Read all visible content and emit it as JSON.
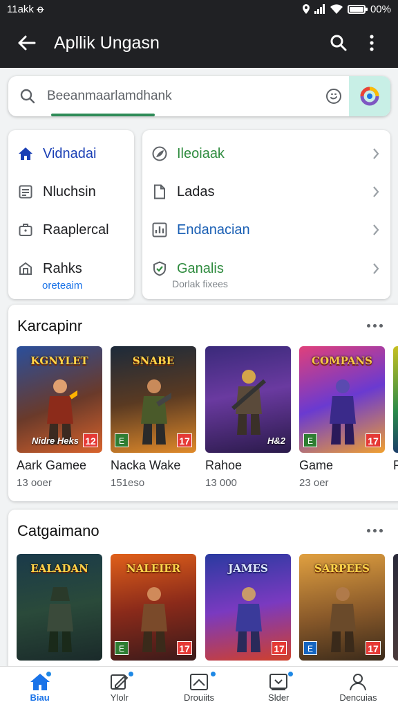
{
  "status_bar": {
    "time": "11akk ꝋ",
    "battery": "00%"
  },
  "app_bar": {
    "title": "Apllik Ungasn"
  },
  "search": {
    "placeholder": "Beeanmaarlamdhank"
  },
  "quick_menu": {
    "left": [
      {
        "label": "Vidnadai",
        "icon": "home-icon",
        "color": "#1a3fb5"
      },
      {
        "label": "Nluchsin",
        "icon": "document-icon",
        "color": "#202124"
      },
      {
        "label": "Raaplercal",
        "icon": "briefcase-icon",
        "color": "#202124"
      },
      {
        "label": "Rahks",
        "icon": "store-icon",
        "color": "#202124",
        "sublabel": "oreteaim"
      }
    ],
    "right": [
      {
        "label": "Ileoiaak",
        "icon": "leaf-icon",
        "color": "#2e8b3e"
      },
      {
        "label": "Ladas",
        "icon": "file-icon",
        "color": "#202124"
      },
      {
        "label": "Endanacian",
        "icon": "chart-icon",
        "color": "#1a5fb4"
      },
      {
        "label": "Ganalis",
        "icon": "shield-icon",
        "color": "#2e8b3e",
        "sublabel": "Dorlak fixees"
      }
    ]
  },
  "sections": [
    {
      "title": "Karcapinr",
      "items": [
        {
          "name": "Aark Gamee",
          "meta": "13 ooer",
          "banner": "KGNYLET",
          "caption": "Nidre Heks",
          "rating": "12"
        },
        {
          "name": "Nacka Wake",
          "meta": "151eso",
          "banner": "SNABE",
          "caption": "",
          "rating": "17"
        },
        {
          "name": "Rahoe",
          "meta": "13 000",
          "banner": "",
          "caption": "H&2",
          "rating": ""
        },
        {
          "name": "Game",
          "meta": "23 oer",
          "banner": "COMPANS",
          "caption": "",
          "rating": "17"
        },
        {
          "name": "P",
          "meta": "",
          "banner": "",
          "caption": "",
          "rating": ""
        }
      ]
    },
    {
      "title": "Catgaimano",
      "items": [
        {
          "name": "",
          "meta": "",
          "banner": "EALADAN",
          "caption": "",
          "rating": ""
        },
        {
          "name": "",
          "meta": "",
          "banner": "NALEIER",
          "caption": "",
          "rating": "17"
        },
        {
          "name": "",
          "meta": "",
          "banner": "JAMES",
          "caption": "",
          "rating": "17"
        },
        {
          "name": "",
          "meta": "",
          "banner": "SARPEES",
          "caption": "",
          "rating": "17"
        }
      ]
    }
  ],
  "bottom_nav": [
    {
      "label": "Biau",
      "icon": "home-icon",
      "active": true
    },
    {
      "label": "Ylolr",
      "icon": "edit-icon",
      "active": false
    },
    {
      "label": "Drouiits",
      "icon": "chart-icon",
      "active": false
    },
    {
      "label": "Slder",
      "icon": "inbox-icon",
      "active": false
    },
    {
      "label": "Dencuias",
      "icon": "person-icon",
      "active": false
    }
  ],
  "colors": {
    "accent": "#1a73e8",
    "appbar": "#202124",
    "lens_bg": "#c8efe6",
    "badge": "#e53935"
  }
}
